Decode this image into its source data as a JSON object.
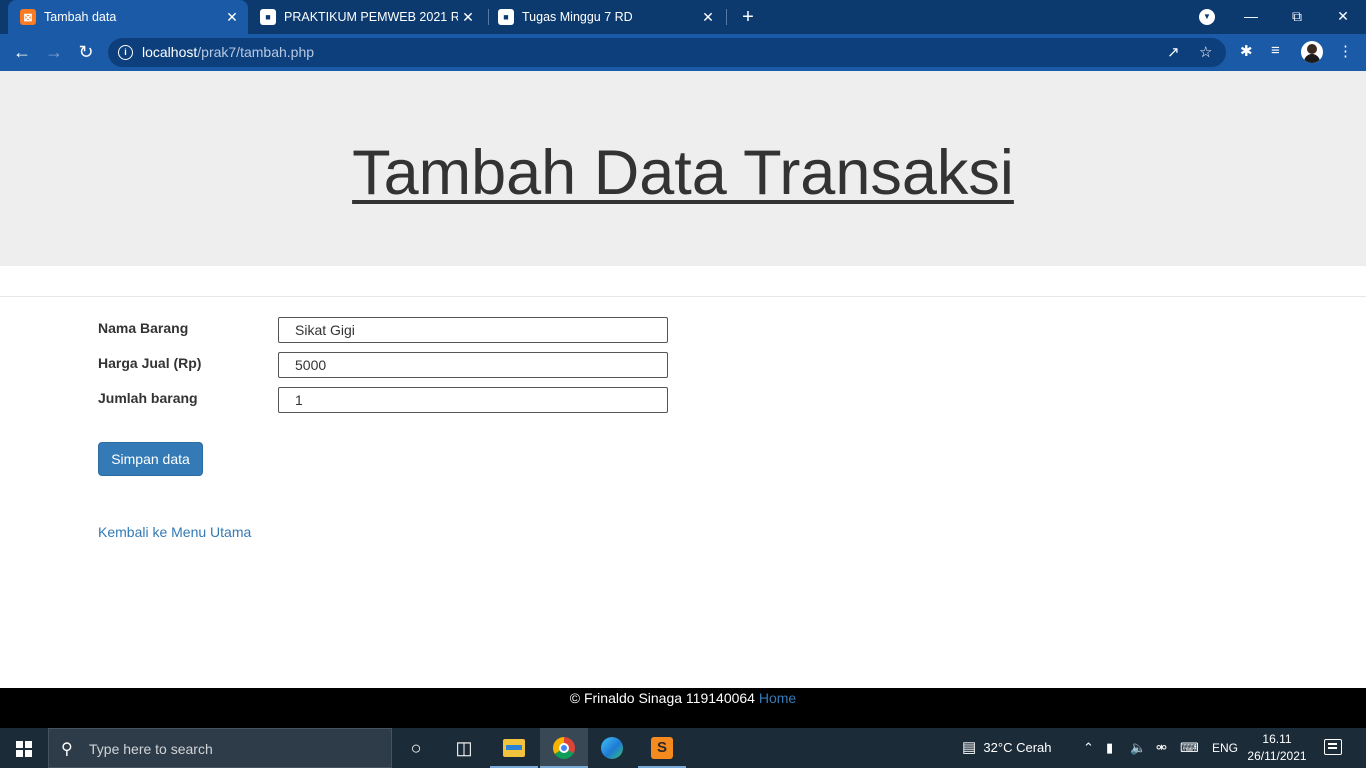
{
  "browser": {
    "tabs": [
      {
        "title": "Tambah data",
        "icon": "xampp-icon"
      },
      {
        "title": "PRAKTIKUM PEMWEB 2021 RA, R",
        "icon": "classroom-icon"
      },
      {
        "title": "Tugas Minggu 7 RD",
        "icon": "classroom-icon"
      }
    ],
    "url_host": "localhost",
    "url_path": "/prak7/tambah.php"
  },
  "page": {
    "title": "Tambah Data Transaksi",
    "form": {
      "fields": [
        {
          "label": "Nama Barang",
          "value": "Sikat Gigi"
        },
        {
          "label": "Harga Jual (Rp)",
          "value": "5000"
        },
        {
          "label": "Jumlah barang",
          "value": "1"
        }
      ],
      "submit_label": "Simpan data"
    },
    "back_link": "Kembali ke Menu Utama",
    "footer_text": "© Frinaldo Sinaga 119140064",
    "footer_link": "Home"
  },
  "taskbar": {
    "search_placeholder": "Type here to search",
    "weather": "32°C  Cerah",
    "language": "ENG",
    "time": "16.11",
    "date": "26/11/2021"
  },
  "colors": {
    "accent": "#337ab7",
    "tabbar": "#0c3a6e",
    "toolbar": "#1a5aa6",
    "jumbotron": "#eeeeee",
    "footer": "#000000"
  }
}
